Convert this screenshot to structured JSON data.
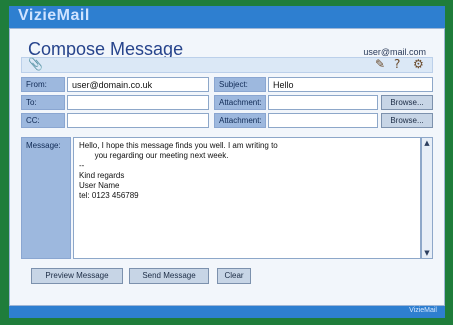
{
  "app": {
    "name": "VizieMail"
  },
  "page": {
    "title": "Compose Message",
    "user": "user@mail.com"
  },
  "fields": {
    "from_label": "From:",
    "from_value": "user@domain.co.uk",
    "to_label": "To:",
    "cc_label": "CC:",
    "subject_label": "Subject:",
    "subject_value": "Hello",
    "attachment1_label": "Attachment:",
    "attachment2_label": "Attachment:",
    "browse_label": "Browse..."
  },
  "message": {
    "label": "Message:",
    "body": "Hello, I hope this message finds you well. I am writing to\n       you regarding our meeting next week.\n--\nKind regards\nUser Name\ntel: 0123 456789"
  },
  "actions": {
    "preview_label": "Preview Message",
    "send_label": "Send Message",
    "clear_label": "Clear"
  },
  "footer": {
    "text": "VizieMail"
  },
  "colors": {
    "background": "#1f7d3b",
    "bar": "#2e7fd0",
    "label_bg": "#9db8de"
  },
  "icons": {
    "attach": "paperclip-icon",
    "address": "address-book-icon",
    "help": "help-icon",
    "settings": "settings-icon"
  }
}
